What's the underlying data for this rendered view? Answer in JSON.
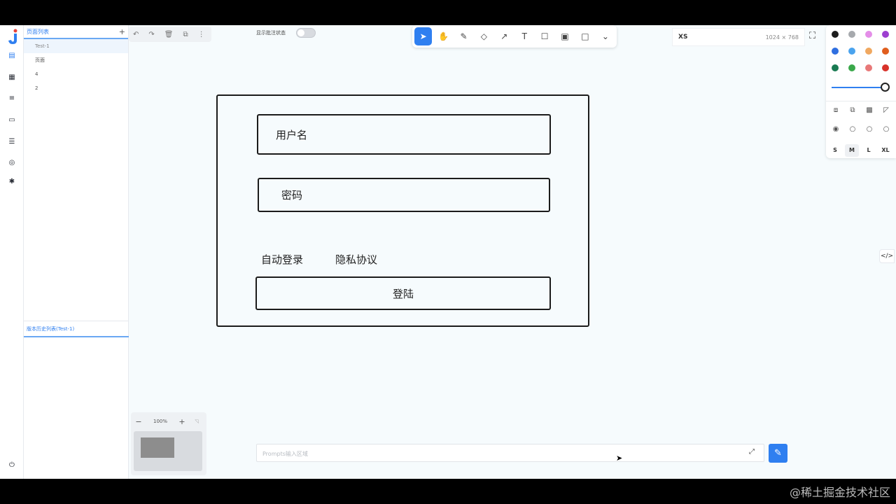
{
  "panel": {
    "title": "页面列表",
    "add_label": "+",
    "pages": [
      "Test-1",
      "页面",
      "4",
      "2"
    ],
    "history_label": "版本历史列表(Test-1)"
  },
  "toolbar": {
    "toggle_label": "显示批注状态"
  },
  "size_selector": {
    "name": "XS",
    "dimensions": "1024 × 768"
  },
  "style_panel": {
    "colors": [
      "#1d1d1d",
      "#a6a9ad",
      "#e48ee8",
      "#9d3fd0",
      "#2f6fe0",
      "#4aa3ee",
      "#f0a860",
      "#e05e1e",
      "#197a52",
      "#3aa84a",
      "#e87878",
      "#d8322a"
    ],
    "sizes": [
      "S",
      "M",
      "L",
      "XL"
    ],
    "active_size": "M"
  },
  "canvas": {
    "username_placeholder": "用户名",
    "password_placeholder": "密码",
    "auto_login": "自动登录",
    "privacy": "隐私协议",
    "login_button": "登陆"
  },
  "zoom": {
    "level": "100%",
    "minus": "−",
    "plus": "+"
  },
  "prompt": {
    "placeholder": "Prompts输入区域"
  },
  "watermark": "@稀土掘金技术社区"
}
